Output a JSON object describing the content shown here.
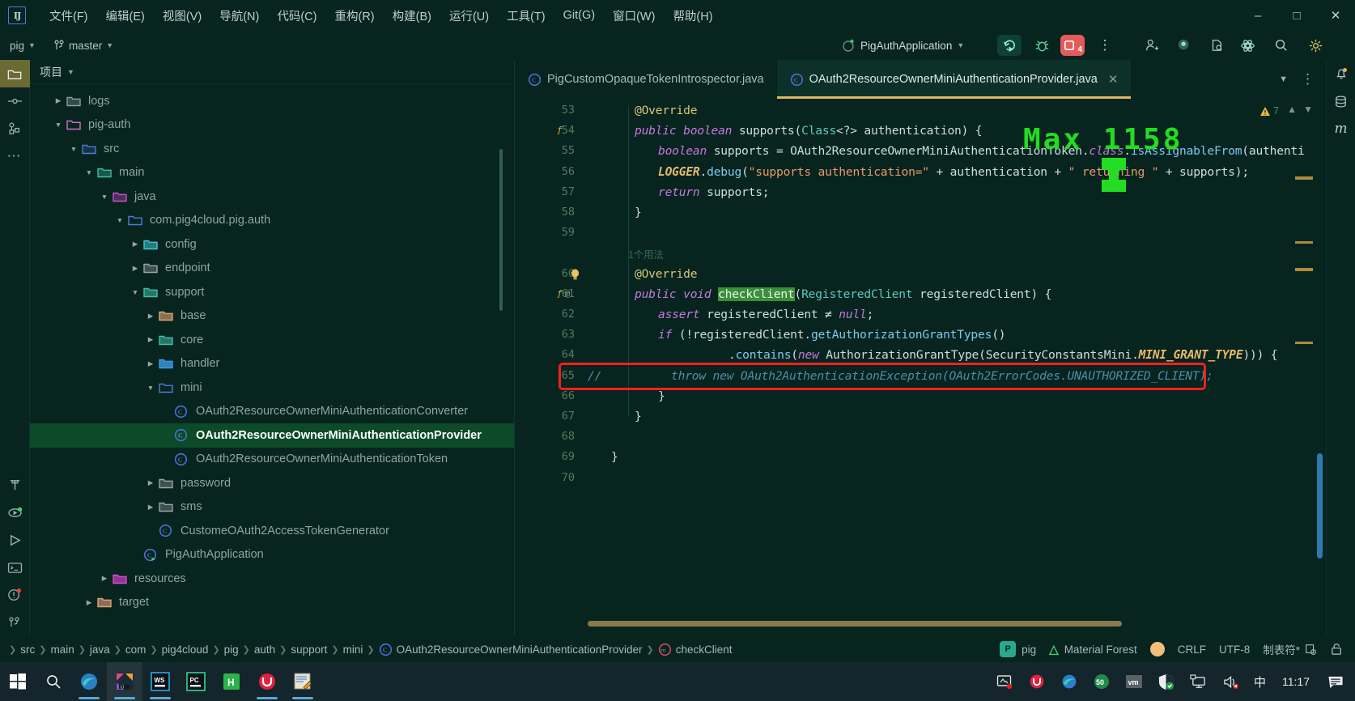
{
  "window": {
    "menu_items": [
      {
        "label": "文件(F)"
      },
      {
        "label": "编辑(E)"
      },
      {
        "label": "视图(V)"
      },
      {
        "label": "导航(N)"
      },
      {
        "label": "代码(C)"
      },
      {
        "label": "重构(R)"
      },
      {
        "label": "构建(B)"
      },
      {
        "label": "运行(U)"
      },
      {
        "label": "工具(T)"
      },
      {
        "label": "Git(G)"
      },
      {
        "label": "窗口(W)"
      },
      {
        "label": "帮助(H)"
      }
    ],
    "minimize": "–",
    "maximize": "□",
    "close": "✕",
    "logo_text": "IJ"
  },
  "navbar": {
    "project_name": "pig",
    "branch_name": "master",
    "run_config": "PigAuthApplication",
    "error_badge_count": "4"
  },
  "project_panel": {
    "title": "项目",
    "tree": [
      {
        "depth": 1,
        "label": "logs",
        "twisty": "›",
        "icon": "folder-slate"
      },
      {
        "depth": 1,
        "label": "pig-auth",
        "twisty": "⌄",
        "icon": "folder-magenta-outline"
      },
      {
        "depth": 2,
        "label": "src",
        "twisty": "⌄",
        "icon": "folder-source"
      },
      {
        "depth": 3,
        "label": "main",
        "twisty": "⌄",
        "icon": "folder-teal"
      },
      {
        "depth": 4,
        "label": "java",
        "twisty": "⌄",
        "icon": "folder-magenta"
      },
      {
        "depth": 5,
        "label": "com.pig4cloud.pig.auth",
        "twisty": "⌄",
        "icon": "folder-blue"
      },
      {
        "depth": 6,
        "label": "config",
        "twisty": "›",
        "icon": "folder-cyan"
      },
      {
        "depth": 6,
        "label": "endpoint",
        "twisty": "›",
        "icon": "folder-grey"
      },
      {
        "depth": 6,
        "label": "support",
        "twisty": "⌄",
        "icon": "folder-greenfill"
      },
      {
        "depth": 7,
        "label": "base",
        "twisty": "›",
        "icon": "folder-orange"
      },
      {
        "depth": 7,
        "label": "core",
        "twisty": "›",
        "icon": "folder-greenfill"
      },
      {
        "depth": 7,
        "label": "handler",
        "twisty": "›",
        "icon": "folder-skyblue"
      },
      {
        "depth": 7,
        "label": "mini",
        "twisty": "⌄",
        "icon": "folder-blue"
      },
      {
        "depth": 8,
        "label": "OAuth2ResourceOwnerMiniAuthenticationConverter",
        "twisty": "",
        "icon": "java-class"
      },
      {
        "depth": 8,
        "label": "OAuth2ResourceOwnerMiniAuthenticationProvider",
        "twisty": "",
        "icon": "java-class",
        "selected": true
      },
      {
        "depth": 8,
        "label": "OAuth2ResourceOwnerMiniAuthenticationToken",
        "twisty": "",
        "icon": "java-class"
      },
      {
        "depth": 7,
        "label": "password",
        "twisty": "›",
        "icon": "folder-grey"
      },
      {
        "depth": 7,
        "label": "sms",
        "twisty": "›",
        "icon": "folder-grey"
      },
      {
        "depth": 7,
        "label": "CustomeOAuth2AccessTokenGenerator",
        "twisty": "",
        "icon": "java-class"
      },
      {
        "depth": 6,
        "label": "PigAuthApplication",
        "twisty": "",
        "icon": "java-class-run"
      },
      {
        "depth": 4,
        "label": "resources",
        "twisty": "›",
        "icon": "folder-pinkfill"
      },
      {
        "depth": 3,
        "label": "target",
        "twisty": "›",
        "icon": "folder-orange"
      }
    ]
  },
  "editor_tabs": [
    {
      "label": "PigCustomOpaqueTokenIntrospector.java",
      "active": false,
      "icon": "java-class"
    },
    {
      "label": "OAuth2ResourceOwnerMiniAuthenticationProvider.java",
      "active": true,
      "icon": "java-class"
    }
  ],
  "editor": {
    "warning_count": "7",
    "lines": [
      {
        "no": "53",
        "gutter": "",
        "indent": 2,
        "tokens": [
          {
            "t": "@Override",
            "c": "ann"
          }
        ]
      },
      {
        "no": "54",
        "gutter": "fx",
        "indent": 2,
        "tokens": [
          {
            "t": "public ",
            "c": "kw"
          },
          {
            "t": "boolean ",
            "c": "kw"
          },
          {
            "t": "supports",
            "c": "id"
          },
          {
            "t": "(",
            "c": "op"
          },
          {
            "t": "Class",
            "c": "typ"
          },
          {
            "t": "<?> ",
            "c": "op"
          },
          {
            "t": "authentication",
            "c": "id"
          },
          {
            "t": ") {",
            "c": "op"
          }
        ]
      },
      {
        "no": "55",
        "gutter": "",
        "indent": 3,
        "tokens": [
          {
            "t": "boolean ",
            "c": "kw"
          },
          {
            "t": "supports = ",
            "c": "id"
          },
          {
            "t": "OAuth2ResourceOwnerMiniAuthenticationToken",
            "c": "id"
          },
          {
            "t": ".",
            "c": "op"
          },
          {
            "t": "class",
            "c": "kw"
          },
          {
            "t": ".",
            "c": "op"
          },
          {
            "t": "isAssignableFrom",
            "c": "fn"
          },
          {
            "t": "(",
            "c": "op"
          },
          {
            "t": "authenti",
            "c": "id"
          }
        ]
      },
      {
        "no": "56",
        "gutter": "",
        "indent": 3,
        "tokens": [
          {
            "t": "LOGGER",
            "c": "fld"
          },
          {
            "t": ".",
            "c": "op"
          },
          {
            "t": "debug",
            "c": "fn"
          },
          {
            "t": "(",
            "c": "op"
          },
          {
            "t": "\"supports authentication=\"",
            "c": "str"
          },
          {
            "t": " + ",
            "c": "op"
          },
          {
            "t": "authentication",
            "c": "id"
          },
          {
            "t": " + ",
            "c": "op"
          },
          {
            "t": "\" returning \"",
            "c": "str"
          },
          {
            "t": " + ",
            "c": "op"
          },
          {
            "t": "supports",
            "c": "id"
          },
          {
            "t": ");",
            "c": "op"
          }
        ]
      },
      {
        "no": "57",
        "gutter": "",
        "indent": 3,
        "tokens": [
          {
            "t": "return ",
            "c": "kw"
          },
          {
            "t": "supports;",
            "c": "id"
          }
        ]
      },
      {
        "no": "58",
        "gutter": "",
        "indent": 2,
        "tokens": [
          {
            "t": "}",
            "c": "op"
          }
        ]
      },
      {
        "no": "59",
        "gutter": "",
        "indent": 0,
        "tokens": []
      },
      {
        "no": "60",
        "gutter": "bulb",
        "indent": 2,
        "tokens": [
          {
            "t": "@Override",
            "c": "ann"
          }
        ],
        "hint": "1个用法"
      },
      {
        "no": "61",
        "gutter": "fx@",
        "indent": 2,
        "tokens": [
          {
            "t": "public ",
            "c": "kw"
          },
          {
            "t": "void ",
            "c": "kw"
          },
          {
            "t": "checkClient",
            "c": "hl-green"
          },
          {
            "t": "(",
            "c": "op"
          },
          {
            "t": "RegisteredClient",
            "c": "typ"
          },
          {
            "t": " registeredClient",
            "c": "id"
          },
          {
            "t": ") {",
            "c": "op"
          }
        ]
      },
      {
        "no": "62",
        "gutter": "",
        "indent": 3,
        "tokens": [
          {
            "t": "assert ",
            "c": "kw"
          },
          {
            "t": "registeredClient ",
            "c": "id"
          },
          {
            "t": "≠ ",
            "c": "op"
          },
          {
            "t": "null",
            "c": "kw"
          },
          {
            "t": ";",
            "c": "op"
          }
        ]
      },
      {
        "no": "63",
        "gutter": "",
        "indent": 3,
        "tokens": [
          {
            "t": "if ",
            "c": "kw"
          },
          {
            "t": "(!",
            "c": "op"
          },
          {
            "t": "registeredClient",
            "c": "id"
          },
          {
            "t": ".",
            "c": "op"
          },
          {
            "t": "getAuthorizationGrantTypes",
            "c": "fn"
          },
          {
            "t": "()",
            "c": "op"
          }
        ]
      },
      {
        "no": "64",
        "gutter": "",
        "indent": 6,
        "tokens": [
          {
            "t": ".",
            "c": "op"
          },
          {
            "t": "contains",
            "c": "fn"
          },
          {
            "t": "(",
            "c": "op"
          },
          {
            "t": "new ",
            "c": "kw"
          },
          {
            "t": "AuthorizationGrantType",
            "c": "id"
          },
          {
            "t": "(",
            "c": "op"
          },
          {
            "t": "SecurityConstantsMini",
            "c": "id"
          },
          {
            "t": ".",
            "c": "op"
          },
          {
            "t": "MINI_GRANT_TYPE",
            "c": "fld"
          },
          {
            "t": "))) {",
            "c": "op"
          }
        ]
      },
      {
        "no": "65",
        "gutter": "",
        "indent": 0,
        "highlighted": true,
        "tokens": [
          {
            "t": "//          throw new OAuth2AuthenticationException(OAuth2ErrorCodes.UNAUTHORIZED_CLIENT);",
            "c": "cmt"
          }
        ]
      },
      {
        "no": "66",
        "gutter": "",
        "indent": 3,
        "tokens": [
          {
            "t": "}",
            "c": "op"
          }
        ]
      },
      {
        "no": "67",
        "gutter": "",
        "indent": 2,
        "tokens": [
          {
            "t": "}",
            "c": "op"
          }
        ]
      },
      {
        "no": "68",
        "gutter": "",
        "indent": 0,
        "tokens": []
      },
      {
        "no": "69",
        "gutter": "",
        "indent": 1,
        "tokens": [
          {
            "t": "}",
            "c": "op"
          }
        ]
      },
      {
        "no": "70",
        "gutter": "",
        "indent": 0,
        "tokens": []
      }
    ]
  },
  "watermark": {
    "text": "Max 1158",
    "color": "#22dd22"
  },
  "breadcrumb": [
    "src",
    "main",
    "java",
    "com",
    "pig4cloud",
    "pig",
    "auth",
    "support",
    "mini",
    "OAuth2ResourceOwnerMiniAuthenticationProvider",
    "checkClient"
  ],
  "status_right": {
    "vcs_badge": "P",
    "vcs_label": "pig",
    "theme_label": "Material Forest",
    "line_separator": "CRLF",
    "encoding": "UTF-8",
    "indent": "制表符*"
  },
  "taskbar": {
    "items": [
      {
        "name": "start-button"
      },
      {
        "name": "search-button"
      },
      {
        "name": "edge-browser"
      },
      {
        "name": "intellij-idea",
        "active": true
      },
      {
        "name": "webstorm"
      },
      {
        "name": "pycharm"
      },
      {
        "name": "hbuilder"
      },
      {
        "name": "ulord"
      },
      {
        "name": "notepad"
      }
    ],
    "tray": [
      {
        "name": "screenshot-tool"
      },
      {
        "name": "ulord-tray"
      },
      {
        "name": "edge-tray"
      },
      {
        "name": "counter-50",
        "label": "50"
      },
      {
        "name": "vmware-tray",
        "label": "vm"
      },
      {
        "name": "defender-tray"
      },
      {
        "name": "network-tray"
      },
      {
        "name": "volume-tray"
      }
    ],
    "ime": "中",
    "clock": "11:17"
  }
}
